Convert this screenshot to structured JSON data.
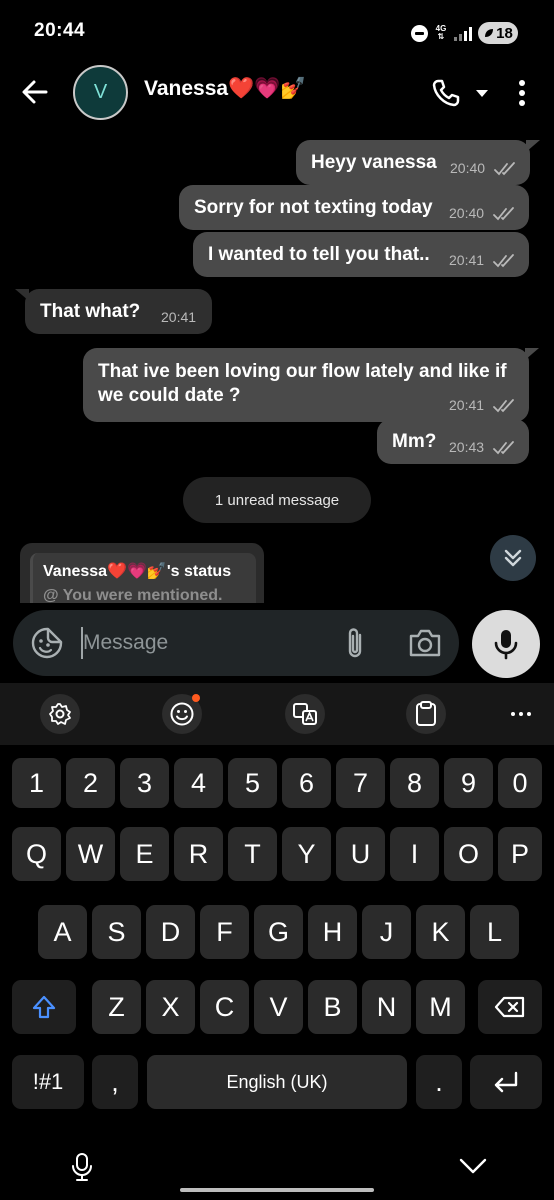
{
  "status_bar": {
    "time": "20:44",
    "network": "4G",
    "battery": "18"
  },
  "header": {
    "avatar_letter": "V",
    "contact_name": "Vanessa❤️💗💅"
  },
  "messages": [
    {
      "direction": "out",
      "text": "Heyy vanessa",
      "time": "20:40",
      "status": "read"
    },
    {
      "direction": "out",
      "text": "Sorry for not texting today",
      "time": "20:40",
      "status": "read"
    },
    {
      "direction": "out",
      "text": "I wanted to tell you that..",
      "time": "20:41",
      "status": "read"
    },
    {
      "direction": "in",
      "text": "That what?",
      "time": "20:41"
    },
    {
      "direction": "out",
      "text": "That ive been loving our flow lately and like if we could date ?",
      "time": "20:41",
      "status": "read"
    },
    {
      "direction": "out",
      "text": "Mm?",
      "time": "20:43",
      "status": "read"
    }
  ],
  "unread_label": "1 unread message",
  "status_reply": {
    "title": "Vanessa❤️💗💅's status",
    "subtitle": "@ You were mentioned."
  },
  "composer": {
    "placeholder": "Message"
  },
  "keyboard": {
    "row_numbers": [
      "1",
      "2",
      "3",
      "4",
      "5",
      "6",
      "7",
      "8",
      "9",
      "0"
    ],
    "row_1": [
      "Q",
      "W",
      "E",
      "R",
      "T",
      "Y",
      "U",
      "I",
      "O",
      "P"
    ],
    "row_2": [
      "A",
      "S",
      "D",
      "F",
      "G",
      "H",
      "J",
      "K",
      "L"
    ],
    "row_3": [
      "Z",
      "X",
      "C",
      "V",
      "B",
      "N",
      "M"
    ],
    "symbols_label": "!#1",
    "comma": ",",
    "space_label": "English (UK)",
    "period": "."
  },
  "colors": {
    "background": "#000000",
    "bubble_outgoing": "#4a4a4a",
    "bubble_incoming": "#2f2f2f",
    "accent_blue": "#4a90ff",
    "notification_dot": "#ff5a1f"
  }
}
